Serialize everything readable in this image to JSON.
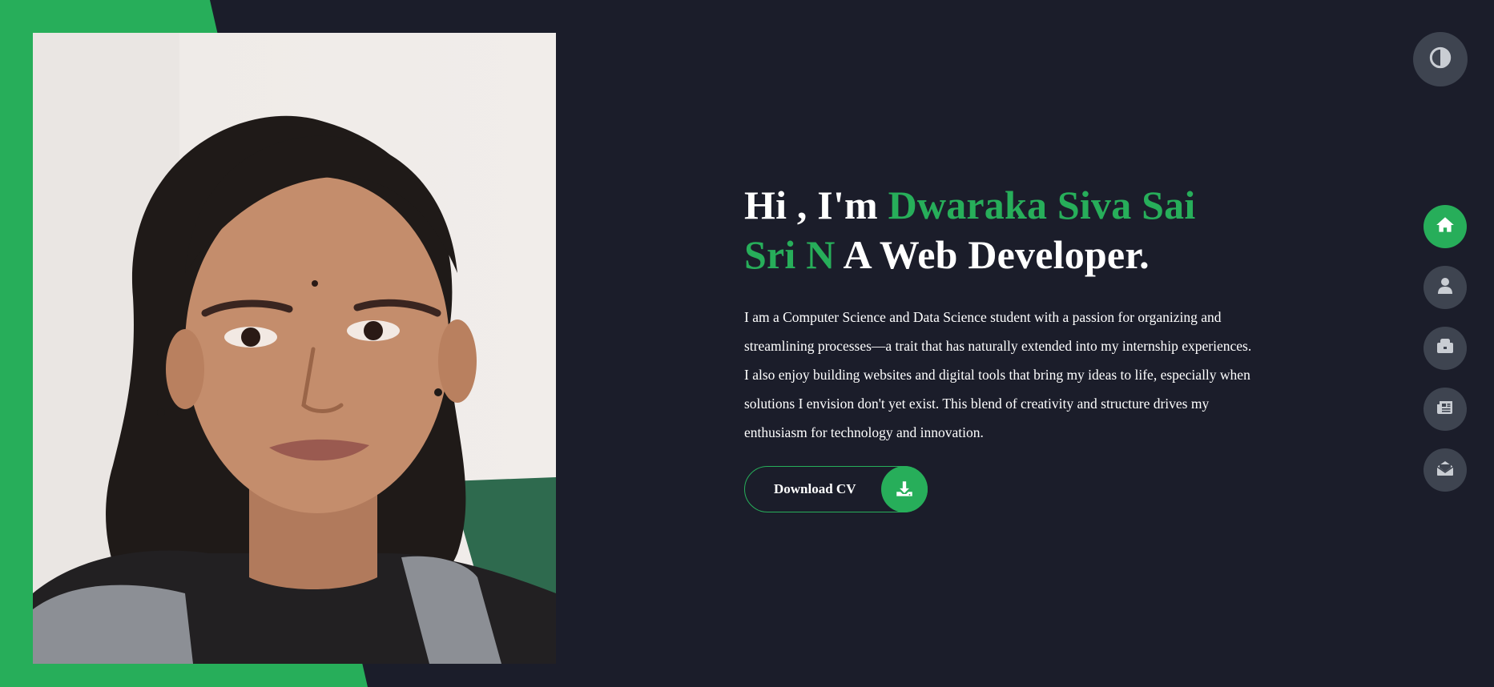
{
  "hero": {
    "greeting": "Hi , I'm ",
    "name": "Dwaraka Siva Sai Sri N",
    "role": " A Web Developer.",
    "description": "I am a Computer Science and Data Science student with a passion for organizing and streamlining processes—a trait that has naturally extended into my internship experiences. I also enjoy building websites and digital tools that bring my ideas to life, especially when solutions I envision don't yet exist. This blend of creativity and structure drives my enthusiasm for technology and innovation.",
    "cv_button_label": "Download CV"
  },
  "nav": {
    "items": [
      {
        "icon": "home-icon",
        "active": true
      },
      {
        "icon": "user-icon",
        "active": false
      },
      {
        "icon": "briefcase-icon",
        "active": false
      },
      {
        "icon": "newspaper-icon",
        "active": false
      },
      {
        "icon": "envelope-open-icon",
        "active": false
      }
    ]
  },
  "theme_toggle": {
    "icon": "contrast-icon"
  },
  "colors": {
    "accent": "#27ae5a",
    "background": "#1b1d2a",
    "button_bg": "#3e4450",
    "text": "#ffffff"
  }
}
